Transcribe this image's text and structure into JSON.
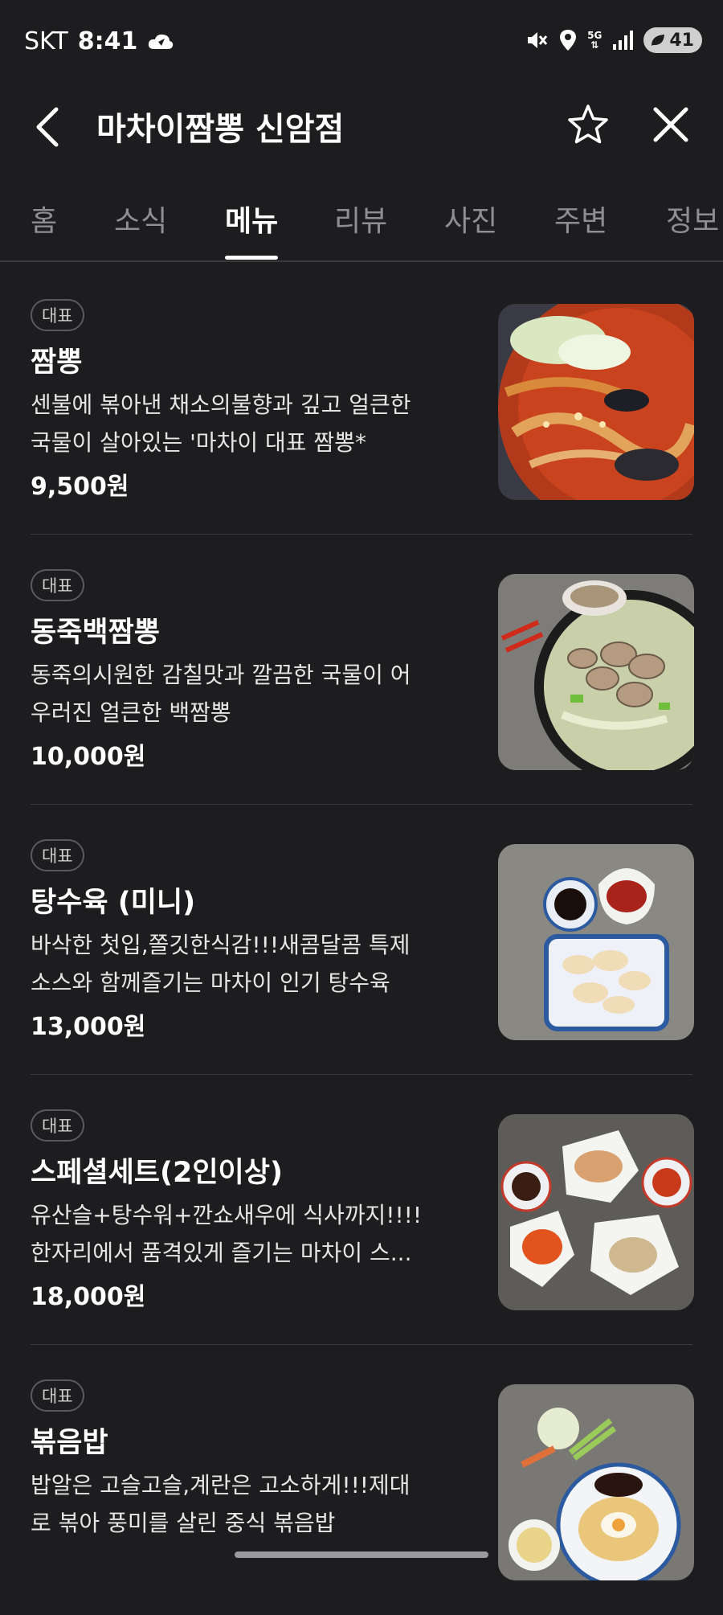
{
  "status": {
    "carrier": "SKT",
    "time": "8:41",
    "network": "5G",
    "battery": "41"
  },
  "header": {
    "title": "마차이짬뽕 신암점"
  },
  "tabs": [
    {
      "label": "홈"
    },
    {
      "label": "소식"
    },
    {
      "label": "메뉴"
    },
    {
      "label": "리뷰"
    },
    {
      "label": "사진"
    },
    {
      "label": "주변"
    },
    {
      "label": "정보"
    }
  ],
  "active_tab": "메뉴",
  "menu": [
    {
      "badge": "대표",
      "name": "짬뽕",
      "desc1": "센불에 볶아낸 채소의불향과 깊고 얼큰한",
      "desc2": "국물이 살아있는 '마차이 대표 짬뽕*",
      "price": "9,500원",
      "image": "jjamppong-photo"
    },
    {
      "badge": "대표",
      "name": "동죽백짬뽕",
      "desc1": "동죽의시원한 감칠맛과 깔끔한 국물이 어",
      "desc2": "우러진 얼큰한 백짬뽕",
      "price": "10,000원",
      "image": "clam-white-jjamppong-photo"
    },
    {
      "badge": "대표",
      "name": "탕수육 (미니)",
      "desc1": "바삭한 첫입,쫄깃한식감!!!새콤달콤 특제",
      "desc2": "소스와 함께즐기는 마차이 인기 탕수육",
      "price": "13,000원",
      "image": "tangsuyuk-photo"
    },
    {
      "badge": "대표",
      "name": "스페셜세트(2인이상)",
      "desc1": "유산슬+탕수워+깐쇼새우에 식사까지!!!!",
      "desc2": "한자리에서 품격있게 즐기는 마차이 스...",
      "price": "18,000원",
      "image": "special-set-photo"
    },
    {
      "badge": "대표",
      "name": "볶음밥",
      "desc1": "밥알은 고슬고슬,계란은 고소하게!!!제대",
      "desc2": "로 볶아 풍미를 살린 중식 볶음밥",
      "price": "",
      "image": "fried-rice-photo"
    }
  ]
}
